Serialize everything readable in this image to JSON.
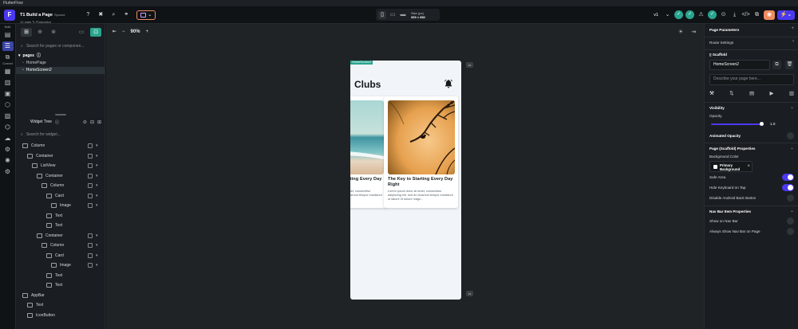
{
  "os": {
    "app_name": "FlutterFlow"
  },
  "topbar": {
    "project_title": "T1 Build a Page",
    "project_tag": "Synced",
    "branch": "main ✎ Production",
    "branch_prefix": "12",
    "device": {
      "size_label": "Size (px)",
      "size_value": "393 × 852"
    },
    "version": "v1",
    "icons": [
      "help-icon",
      "shortcut-icon",
      "search-icon",
      "share-icon",
      "theme-icon"
    ]
  },
  "rail": {
    "build_label": "Build",
    "connect_label": "Connect"
  },
  "left": {
    "search_placeholder": "Search for pages or componen...",
    "pages_label": "pages",
    "pages": [
      "HomePage",
      "HomeScreen2"
    ],
    "widget_tree_label": "Widget Tree",
    "widget_search_placeholder": "Search for widget...",
    "tree": [
      {
        "name": "Column",
        "indent": 0
      },
      {
        "name": "Container",
        "indent": 1
      },
      {
        "name": "ListView",
        "indent": 2
      },
      {
        "name": "Container",
        "indent": 3
      },
      {
        "name": "Column",
        "indent": 4
      },
      {
        "name": "Card",
        "indent": 5
      },
      {
        "name": "Image",
        "indent": 6
      },
      {
        "name": "Text",
        "indent": 5
      },
      {
        "name": "Text",
        "indent": 5
      },
      {
        "name": "Container",
        "indent": 3
      },
      {
        "name": "Column",
        "indent": 4
      },
      {
        "name": "Card",
        "indent": 5
      },
      {
        "name": "Image",
        "indent": 6
      },
      {
        "name": "Text",
        "indent": 5
      },
      {
        "name": "Text",
        "indent": 5
      },
      {
        "name": "AppBar",
        "indent": 0
      },
      {
        "name": "Text",
        "indent": 1
      },
      {
        "name": "IconButton",
        "indent": 1
      }
    ]
  },
  "canvas": {
    "zoom": "90%",
    "page_tag": "HomeScreen2",
    "app_title": "Clubs",
    "cards": [
      {
        "title": "The Key to Starting Every Day Right",
        "body": "Lorem ipsum dolor sit amet, consectetur adipiscing elit, sed do eiusmod tempor incididunt ut labore et dolore magn..."
      },
      {
        "title": "The Key to Starting Every Day Right",
        "body": "Lorem ipsum dolor sit amet, consectetur adipiscing elit, sed do eiusmod tempor incididunt ut labore et dolore magn..."
      }
    ]
  },
  "right": {
    "page_parameters": "Page Parameters",
    "route_settings": "Route Settings",
    "scaffold_label": "Scaffold",
    "page_name": "HomeScreen2",
    "description_placeholder": "Describe your page here...",
    "visibility": "Visibility",
    "opacity_label": "Opacity",
    "opacity_value": "1.0",
    "animated_opacity": "Animated Opacity",
    "scaffold_props": "Page (Scaffold) Properties",
    "bg_color_label": "Background Color",
    "bg_color_value_1": "Primary",
    "bg_color_value_2": "Background",
    "safe_area": "Safe Area",
    "hide_keyboard": "Hide Keyboard on Tap",
    "disable_back": "Disable Android Back Button",
    "nav_props": "Nav Bar Item Properties",
    "show_nav": "Show on Nav Bar",
    "always_show_nav": "Always Show Nav Bar on Page",
    "safe_area_on": true,
    "hide_keyboard_on": true
  },
  "colors": {
    "primary": "#4b39ef",
    "secondary": "#2aa48f",
    "accent": "#ee8b60"
  }
}
